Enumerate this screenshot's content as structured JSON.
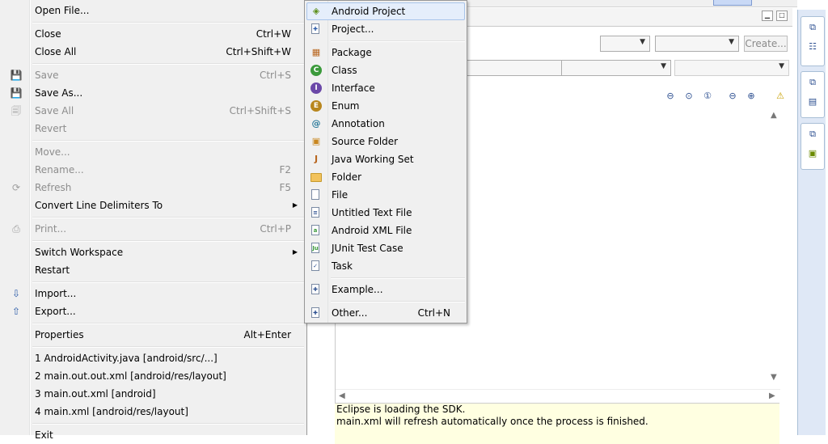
{
  "file_menu": {
    "items": [
      {
        "label": "Open File...",
        "accel": "",
        "disabled": false,
        "icon": ""
      },
      {
        "label": "Close",
        "accel": "Ctrl+W",
        "disabled": false,
        "icon": ""
      },
      {
        "label": "Close All",
        "accel": "Ctrl+Shift+W",
        "disabled": false,
        "icon": ""
      },
      {
        "label": "Save",
        "accel": "Ctrl+S",
        "disabled": true,
        "icon": "save-icon"
      },
      {
        "label": "Save As...",
        "accel": "",
        "disabled": false,
        "icon": "save-as-icon"
      },
      {
        "label": "Save All",
        "accel": "Ctrl+Shift+S",
        "disabled": true,
        "icon": "save-all-icon"
      },
      {
        "label": "Revert",
        "accel": "",
        "disabled": true,
        "icon": ""
      },
      {
        "label": "Move...",
        "accel": "",
        "disabled": true,
        "icon": ""
      },
      {
        "label": "Rename...",
        "accel": "F2",
        "disabled": true,
        "icon": ""
      },
      {
        "label": "Refresh",
        "accel": "F5",
        "disabled": true,
        "icon": "refresh-icon"
      },
      {
        "label": "Convert Line Delimiters To",
        "accel": "",
        "disabled": false,
        "icon": ""
      },
      {
        "label": "Print...",
        "accel": "Ctrl+P",
        "disabled": true,
        "icon": "print-icon"
      },
      {
        "label": "Switch Workspace",
        "accel": "",
        "disabled": false,
        "icon": ""
      },
      {
        "label": "Restart",
        "accel": "",
        "disabled": false,
        "icon": ""
      },
      {
        "label": "Import...",
        "accel": "",
        "disabled": false,
        "icon": "import-icon"
      },
      {
        "label": "Export...",
        "accel": "",
        "disabled": false,
        "icon": "export-icon"
      },
      {
        "label": "Properties",
        "accel": "Alt+Enter",
        "disabled": false,
        "icon": ""
      },
      {
        "label": "1 AndroidActivity.java  [android/src/...]",
        "accel": "",
        "disabled": false,
        "icon": ""
      },
      {
        "label": "2 main.out.out.xml  [android/res/layout]",
        "accel": "",
        "disabled": false,
        "icon": ""
      },
      {
        "label": "3 main.out.xml  [android]",
        "accel": "",
        "disabled": false,
        "icon": ""
      },
      {
        "label": "4 main.xml  [android/res/layout]",
        "accel": "",
        "disabled": false,
        "icon": ""
      },
      {
        "label": "Exit",
        "accel": "",
        "disabled": false,
        "icon": ""
      }
    ]
  },
  "new_submenu": {
    "items": [
      {
        "label": "Android Project",
        "accel": "",
        "icon": "android-project-icon",
        "selected": true
      },
      {
        "label": "Project...",
        "accel": "",
        "icon": "project-icon",
        "selected": false
      },
      {
        "label": "Package",
        "accel": "",
        "icon": "package-icon",
        "selected": false
      },
      {
        "label": "Class",
        "accel": "",
        "icon": "class-icon",
        "selected": false
      },
      {
        "label": "Interface",
        "accel": "",
        "icon": "interface-icon",
        "selected": false
      },
      {
        "label": "Enum",
        "accel": "",
        "icon": "enum-icon",
        "selected": false
      },
      {
        "label": "Annotation",
        "accel": "",
        "icon": "annotation-icon",
        "selected": false
      },
      {
        "label": "Source Folder",
        "accel": "",
        "icon": "source-folder-icon",
        "selected": false
      },
      {
        "label": "Java Working Set",
        "accel": "",
        "icon": "working-set-icon",
        "selected": false
      },
      {
        "label": "Folder",
        "accel": "",
        "icon": "folder-icon",
        "selected": false
      },
      {
        "label": "File",
        "accel": "",
        "icon": "file-icon",
        "selected": false
      },
      {
        "label": "Untitled Text File",
        "accel": "",
        "icon": "text-file-icon",
        "selected": false
      },
      {
        "label": "Android XML File",
        "accel": "",
        "icon": "android-xml-icon",
        "selected": false
      },
      {
        "label": "JUnit Test Case",
        "accel": "",
        "icon": "junit-icon",
        "selected": false
      },
      {
        "label": "Task",
        "accel": "",
        "icon": "task-icon",
        "selected": false
      },
      {
        "label": "Example...",
        "accel": "",
        "icon": "example-icon",
        "selected": false
      },
      {
        "label": "Other...",
        "accel": "Ctrl+N",
        "icon": "other-icon",
        "selected": false
      }
    ]
  },
  "editor": {
    "create_button": "Create...",
    "info_line1": "Eclipse is loading the SDK.",
    "info_line2": "main.xml will refresh automatically once the process is finished."
  }
}
